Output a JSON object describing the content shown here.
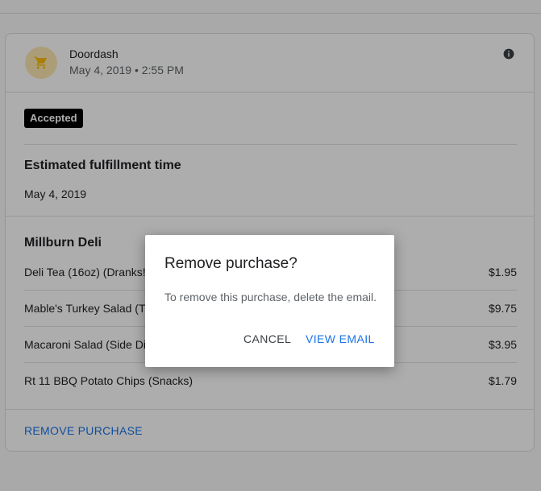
{
  "merchant": {
    "name": "Doordash",
    "datetime": "May 4, 2019 • 2:55 PM",
    "icon": "shopping-cart-icon",
    "icon_color": "#fbbc04"
  },
  "status": {
    "label": "Accepted"
  },
  "fulfillment": {
    "title": "Estimated fulfillment time",
    "date": "May 4, 2019"
  },
  "order": {
    "store": "Millburn Deli",
    "items": [
      {
        "name": "Deli Tea (16oz) (Dranks!)",
        "price": "$1.95"
      },
      {
        "name": "Mable's Turkey Salad (Turkey)",
        "price": "$9.75"
      },
      {
        "name": "Macaroni Salad (Side Dishes)",
        "price": "$3.95"
      },
      {
        "name": "Rt 11 BBQ Potato Chips (Snacks)",
        "price": "$1.79"
      }
    ]
  },
  "actions": {
    "remove_purchase": "REMOVE PURCHASE"
  },
  "dialog": {
    "title": "Remove purchase?",
    "message": "To remove this purchase, delete the email.",
    "cancel": "CANCEL",
    "view_email": "VIEW EMAIL"
  },
  "colors": {
    "accent": "#1a73e8",
    "badge_bg": "#000000",
    "scrim": "rgba(0,0,0,0.32)"
  }
}
